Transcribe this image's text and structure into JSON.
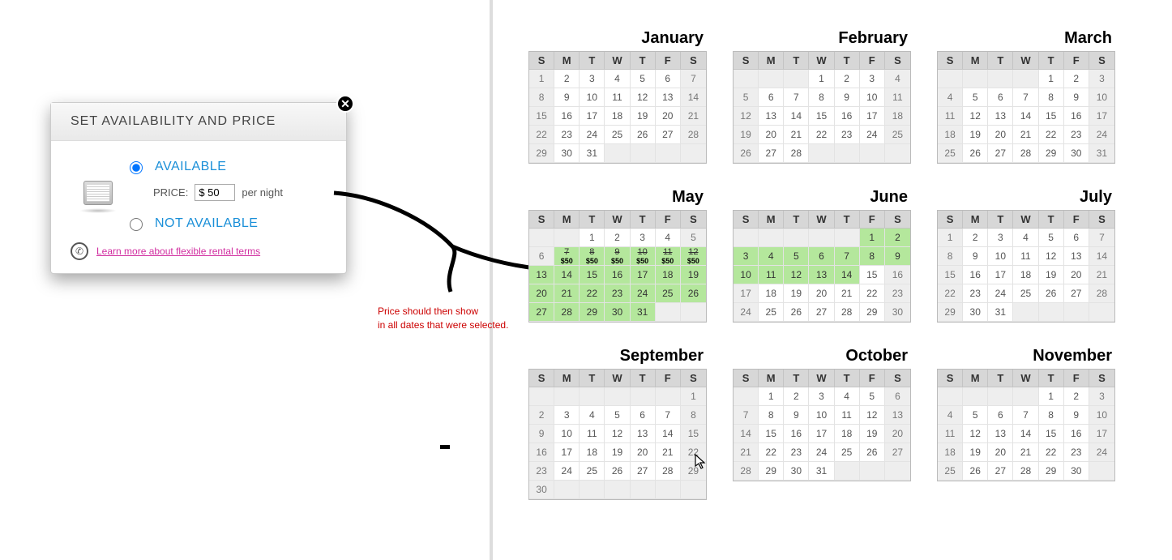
{
  "dialog": {
    "title": "SET AVAILABILITY AND PRICE",
    "available_label": "AVAILABLE",
    "not_available_label": "NOT AVAILABLE",
    "price_label": "PRICE:",
    "price_value": "$ 50",
    "per_night": "per night",
    "learn_link": "Learn more about flexible rental terms"
  },
  "annotation": {
    "line1": "Price should then show",
    "line2": "in all dates that were selected."
  },
  "day_headers": [
    "S",
    "M",
    "T",
    "W",
    "T",
    "F",
    "S"
  ],
  "price_tag": "$50",
  "months": [
    {
      "name": "January",
      "start": 0,
      "days": 31,
      "sel": []
    },
    {
      "name": "February",
      "start": 3,
      "days": 28,
      "sel": []
    },
    {
      "name": "March",
      "start": 4,
      "days": 31,
      "sel": []
    },
    {
      "name": "May",
      "start": 2,
      "days": 31,
      "sel_from": 7,
      "sel_to": 31,
      "price_row": [
        7,
        8,
        9,
        10,
        11,
        12
      ]
    },
    {
      "name": "June",
      "start": 5,
      "days": 30,
      "sel_from": 1,
      "sel_to": 14
    },
    {
      "name": "July",
      "start": 0,
      "days": 31,
      "sel": []
    },
    {
      "name": "September",
      "start": 6,
      "days": 30,
      "sel": []
    },
    {
      "name": "October",
      "start": 1,
      "days": 31,
      "sel": []
    },
    {
      "name": "November",
      "start": 4,
      "days": 30,
      "sel": []
    }
  ]
}
